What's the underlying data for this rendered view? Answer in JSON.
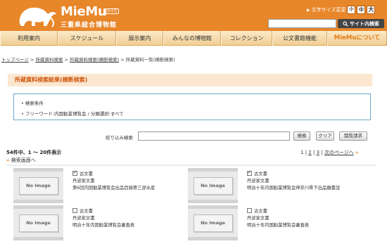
{
  "header": {
    "logo_text": "MieMu",
    "logo_sub": "みえむ",
    "logo_jp": "三重県総合博物館",
    "fontsize_label": "文字サイズ変更",
    "fontsize_small": "小",
    "fontsize_medium": "中",
    "fontsize_large": "大",
    "search_button": "サイト内検索",
    "colors": {
      "brand": "#e8862a",
      "nav_bg": "#f1cf95",
      "accent_text": "#e07b14"
    }
  },
  "nav": {
    "items": [
      "利用案内",
      "スケジュール",
      "展示案内",
      "みんなの博物館",
      "コレクション",
      "公文書館機能",
      "MieMuについて"
    ]
  },
  "breadcrumb": {
    "items": [
      "トップページ",
      "所蔵資料検索",
      "所蔵資料検索(横断検索)",
      "所蔵資料一覧(横断検索)"
    ],
    "separator": " > "
  },
  "section": {
    "title": "所蔵資料検索結果(横断検索)"
  },
  "conditions": {
    "heading": "検索条件",
    "query": "フリーワード:内国勧業博覧会 / 分類選択:すべて"
  },
  "filter": {
    "label": "絞り込み検索",
    "search_button": "検索",
    "clear_button": "クリア",
    "request_button": "閲覧請求"
  },
  "results": {
    "count_text": "54件中、1 〜 20件表示",
    "back_text": "検索画面へ",
    "pager": {
      "current": "1",
      "page2": "2",
      "page3": "3",
      "next": "次のページへ"
    },
    "items": [
      {
        "image": "No Image",
        "checked": true,
        "type": "古文書",
        "collection": "丹波家文書",
        "title": "第6回内国勧業博覧会出品目録第三部水産"
      },
      {
        "image": "No Image",
        "checked": true,
        "type": "古文書",
        "collection": "丹波家文書",
        "title": "明治十年内国勧業博覧会神奈川県下出品願書証"
      },
      {
        "image": "No Image",
        "checked": false,
        "type": "古文書",
        "collection": "丹波家文書",
        "title": "明治十年内国勧業博覧会審査表"
      },
      {
        "image": "No Image",
        "checked": false,
        "type": "古文書",
        "collection": "丹波家文書",
        "title": "明治十年内国勧業博覧会審査表"
      }
    ]
  }
}
